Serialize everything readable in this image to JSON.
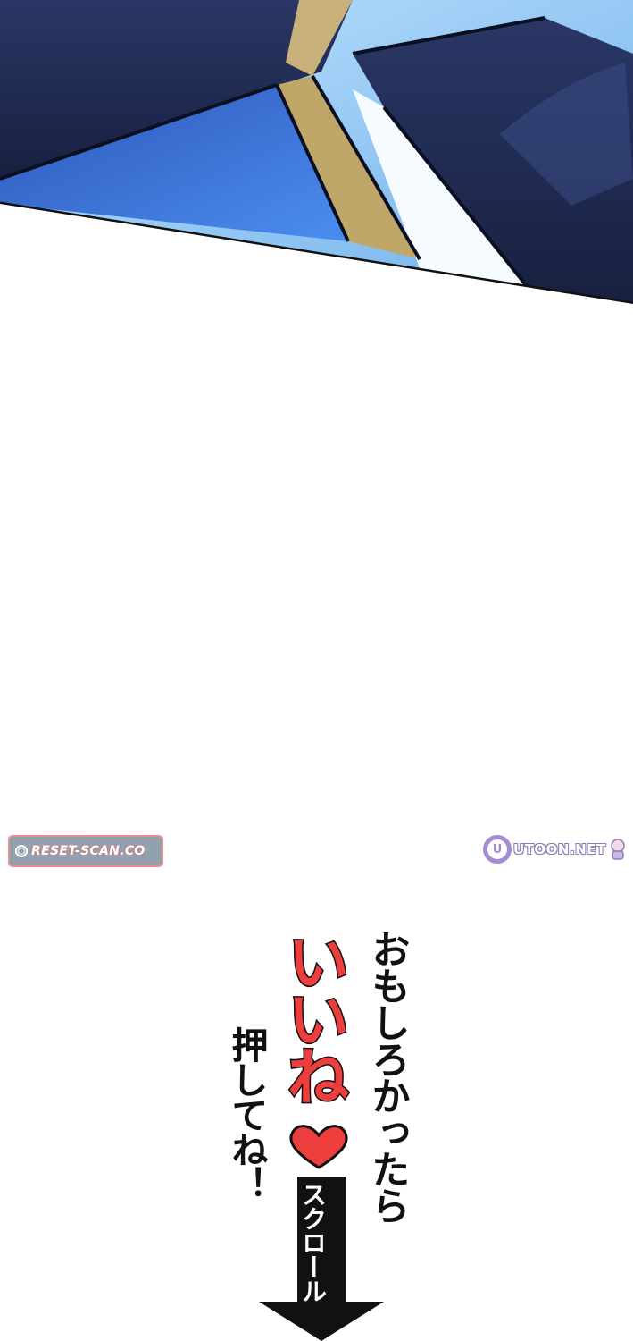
{
  "watermarks": {
    "left_text": "RESET-SCAN.CO",
    "right_text": "UTOON.NET"
  },
  "message": {
    "line1": "おもしろかったら",
    "highlight": "いいね",
    "line3": "押してね！",
    "scroll_label": "スクロール！"
  },
  "colors": {
    "highlight": "#ee3d3d",
    "heart": "#ee3d3d",
    "art_navy": "#1e2a4f",
    "art_blue": "#3a6fd6",
    "sky": "#8fc6f0"
  },
  "icons": [
    "heart-icon",
    "down-arrow-icon",
    "reset-scan-logo",
    "utoon-logo"
  ]
}
